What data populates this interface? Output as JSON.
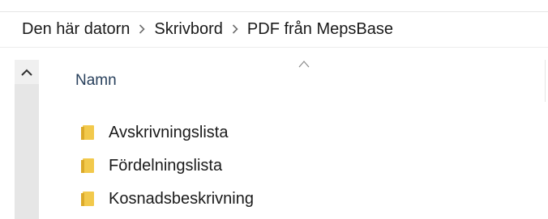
{
  "breadcrumb": {
    "items": [
      {
        "label": "Den här datorn"
      },
      {
        "label": "Skrivbord"
      },
      {
        "label": "PDF från MepsBase"
      }
    ],
    "separator_icon": "chevron-right-icon"
  },
  "navigation_pane": {
    "scroll_up_icon": "chevron-up-icon"
  },
  "file_list": {
    "column_header": "Namn",
    "sort_indicator_icon": "sort-ascending-icon",
    "items": [
      {
        "label": "Avskrivningslista",
        "icon": "folder-icon"
      },
      {
        "label": "Fördelningslista",
        "icon": "folder-icon"
      },
      {
        "label": "Kosnadsbeskrivning",
        "icon": "folder-icon"
      }
    ]
  },
  "colors": {
    "folder": "#f2c94c",
    "header_text": "#28405c",
    "nav_pane_bg": "#e6e6e6"
  }
}
